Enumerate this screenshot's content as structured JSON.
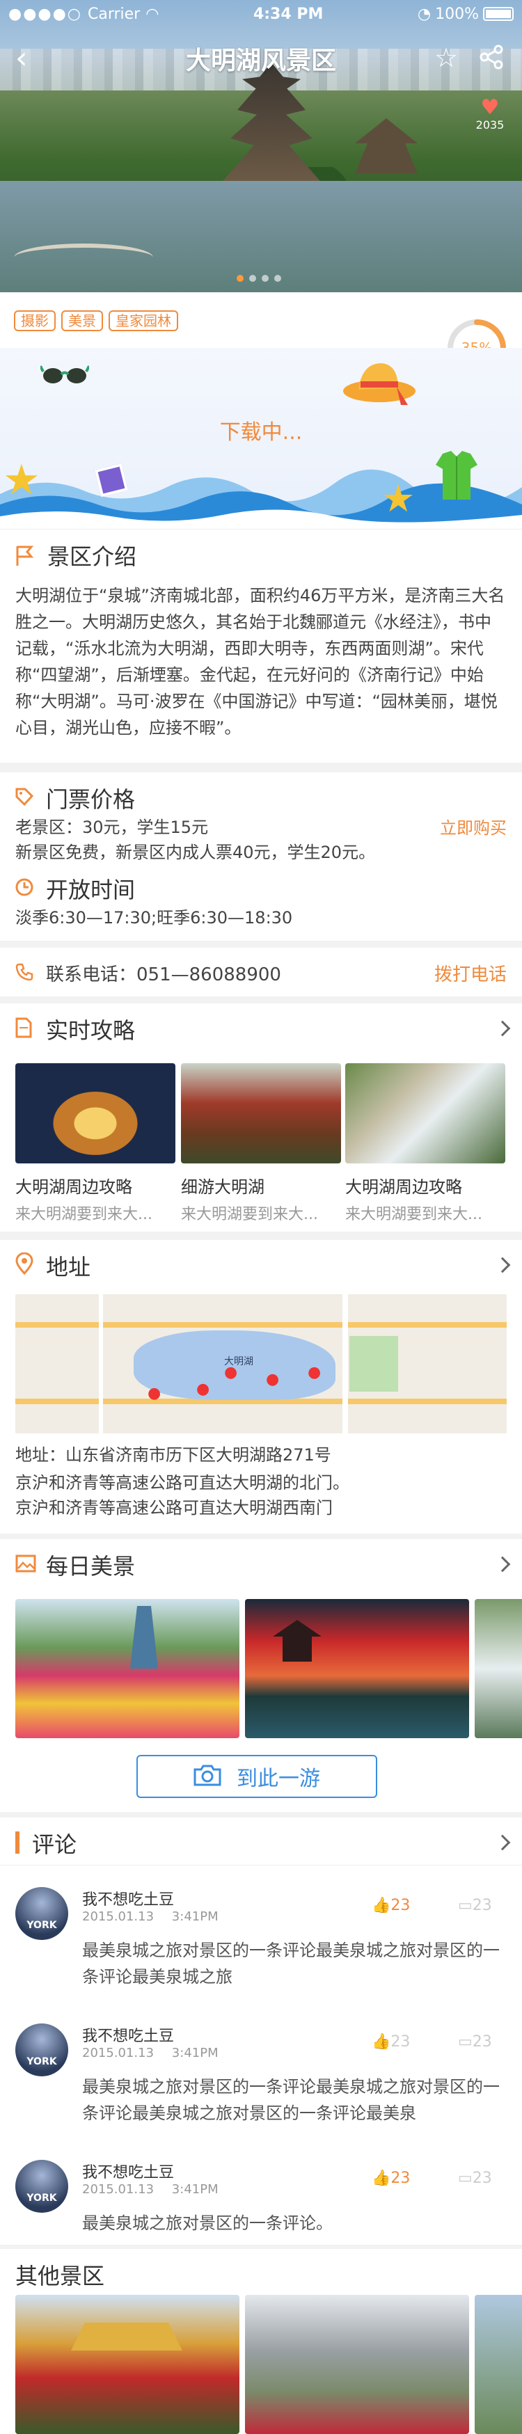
{
  "status": {
    "carrier": "Carrier",
    "time": "4:34 PM",
    "battery": "100%"
  },
  "nav": {
    "title": "大明湖风景区",
    "likes": "2035"
  },
  "tags": [
    "摄影",
    "美景",
    "皇家园林"
  ],
  "download": {
    "label": "下载中...",
    "progress": 0.35,
    "progress_label": "35%"
  },
  "intro": {
    "title": "景区介绍",
    "text": "大明湖位于“泉城”济南城北部，面积约46万平方米，是济南三大名胜之一。大明湖历史悠久，其名始于北魏郦道元《水经注》，书中记载，“泺水北流为大明湖，西即大明寺，东西两面则湖”。宋代称“四望湖”，后渐堙塞。金代起，在元好问的《济南行记》中始称“大明湖”。马可·波罗在《中国游记》中写道：“园林美丽，堪悦心目，湖光山色，应接不暇”。"
  },
  "ticket": {
    "title": "门票价格",
    "buy": "立即购买",
    "line1": "老景区：30元，学生15元",
    "line2": "新景区免费，新景区内成人票40元，学生20元。"
  },
  "hours": {
    "title": "开放时间",
    "text": "淡季6:30—17:30;旺季6:30—18:30"
  },
  "phone": {
    "label": "联系电话：051—86088900",
    "action": "拨打电话"
  },
  "guides": {
    "title": "实时攻略",
    "items": [
      {
        "title": "大明湖周边攻略",
        "sub": "来大明湖要到来大..."
      },
      {
        "title": "细游大明湖",
        "sub": "来大明湖要到来大..."
      },
      {
        "title": "大明湖周边攻略",
        "sub": "来大明湖要到来大..."
      }
    ]
  },
  "address": {
    "title": "地址",
    "line1": "地址：山东省济南市历下区大明湖路271号",
    "line2": "京沪和济青等高速公路可直达大明湖的北门。",
    "line3": "京沪和济青等高速公路可直达大明湖西南门",
    "map_label": "大明湖"
  },
  "daily": {
    "title": "每日美景",
    "button": "到此一游"
  },
  "comments": {
    "title": "评论",
    "items": [
      {
        "user": "我不想吃土豆",
        "date": "2015.01.13",
        "time": "3:41PM",
        "likes": "23",
        "replies": "23",
        "text": "最美泉城之旅对景区的一条评论最美泉城之旅对景区的一条评论最美泉城之旅"
      },
      {
        "user": "我不想吃土豆",
        "date": "2015.01.13",
        "time": "3:41PM",
        "likes": "23",
        "replies": "23",
        "text": "最美泉城之旅对景区的一条评论最美泉城之旅对景区的一条评论最美泉城之旅对景区的一条评论最美泉"
      },
      {
        "user": "我不想吃土豆",
        "date": "2015.01.13",
        "time": "3:41PM",
        "likes": "23",
        "replies": "23",
        "text": "最美泉城之旅对景区的一条评论。"
      }
    ]
  },
  "others": {
    "title": "其他景区"
  },
  "colors": {
    "accent": "#f08a3c",
    "blue": "#3a8de0"
  }
}
